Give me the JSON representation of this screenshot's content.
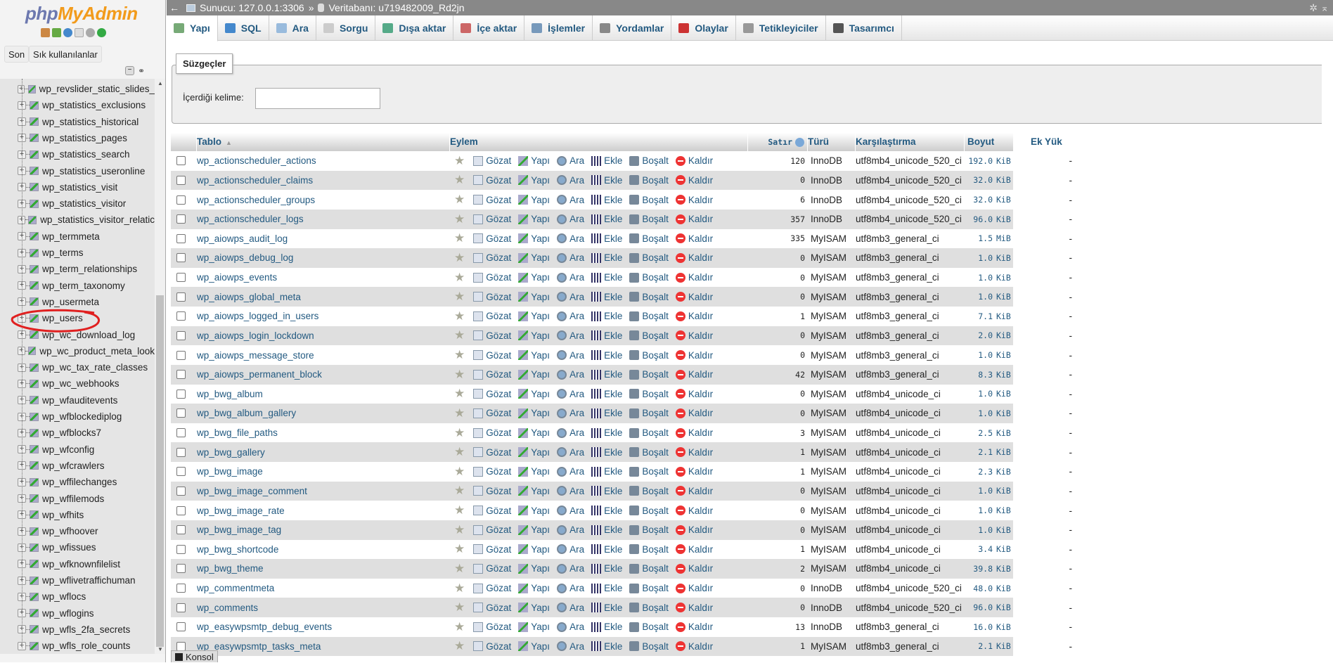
{
  "sidebar": {
    "logo": {
      "php": "php",
      "myadmin": "MyAdmin"
    },
    "quick_icons": [
      "home-icon",
      "exit-icon",
      "help-icon",
      "docs-icon",
      "settings-icon",
      "reload-icon"
    ],
    "buttons": {
      "recent": "Son",
      "favorites": "Sık kullanılanlar"
    },
    "tables": [
      "wp_revslider_static_slides_",
      "wp_statistics_exclusions",
      "wp_statistics_historical",
      "wp_statistics_pages",
      "wp_statistics_search",
      "wp_statistics_useronline",
      "wp_statistics_visit",
      "wp_statistics_visitor",
      "wp_statistics_visitor_relatic",
      "wp_termmeta",
      "wp_terms",
      "wp_term_relationships",
      "wp_term_taxonomy",
      "wp_usermeta",
      "wp_users",
      "wp_wc_download_log",
      "wp_wc_product_meta_look",
      "wp_wc_tax_rate_classes",
      "wp_wc_webhooks",
      "wp_wfauditevents",
      "wp_wfblockediplog",
      "wp_wfblocks7",
      "wp_wfconfig",
      "wp_wfcrawlers",
      "wp_wffilechanges",
      "wp_wffilemods",
      "wp_wfhits",
      "wp_wfhoover",
      "wp_wfissues",
      "wp_wfknownfilelist",
      "wp_wflivetraffichuman",
      "wp_wflocs",
      "wp_wflogins",
      "wp_wfls_2fa_secrets",
      "wp_wfls_role_counts"
    ],
    "highlighted": "wp_users",
    "annotation_color": "#e02020"
  },
  "breadcrumb": {
    "server": "Sunucu: 127.0.0.1:3306",
    "sep": "»",
    "database": "Veritabanı: u719482009_Rd2jn"
  },
  "tabs": [
    {
      "label": "Yapı",
      "icon": "structure-icon",
      "active": true
    },
    {
      "label": "SQL",
      "icon": "sql-icon"
    },
    {
      "label": "Ara",
      "icon": "search-icon"
    },
    {
      "label": "Sorgu",
      "icon": "query-icon"
    },
    {
      "label": "Dışa aktar",
      "icon": "export-icon"
    },
    {
      "label": "İçe aktar",
      "icon": "import-icon"
    },
    {
      "label": "İşlemler",
      "icon": "wrench-icon"
    },
    {
      "label": "Yordamlar",
      "icon": "routines-icon"
    },
    {
      "label": "Olaylar",
      "icon": "clock-icon"
    },
    {
      "label": "Tetikleyiciler",
      "icon": "triggers-icon"
    },
    {
      "label": "Tasarımcı",
      "icon": "designer-icon"
    }
  ],
  "filters": {
    "legend": "Süzgeçler",
    "label": "İçerdiği kelime:",
    "value": ""
  },
  "table": {
    "headers": {
      "name": "Tablo",
      "action": "Eylem",
      "rows": "Satır",
      "engine": "Türü",
      "collation": "Karşılaştırma",
      "size": "Boyut",
      "overhead": "Ek Yük"
    },
    "actions": [
      "Gözat",
      "Yapı",
      "Ara",
      "Ekle",
      "Boşalt",
      "Kaldır"
    ],
    "rows": [
      {
        "name": "wp_actionscheduler_actions",
        "rows": "120",
        "engine": "InnoDB",
        "collation": "utf8mb4_unicode_520_ci",
        "size": "192.0",
        "unit": "KiB",
        "overhead": "-"
      },
      {
        "name": "wp_actionscheduler_claims",
        "rows": "0",
        "engine": "InnoDB",
        "collation": "utf8mb4_unicode_520_ci",
        "size": "32.0",
        "unit": "KiB",
        "overhead": "-"
      },
      {
        "name": "wp_actionscheduler_groups",
        "rows": "6",
        "engine": "InnoDB",
        "collation": "utf8mb4_unicode_520_ci",
        "size": "32.0",
        "unit": "KiB",
        "overhead": "-"
      },
      {
        "name": "wp_actionscheduler_logs",
        "rows": "357",
        "engine": "InnoDB",
        "collation": "utf8mb4_unicode_520_ci",
        "size": "96.0",
        "unit": "KiB",
        "overhead": "-"
      },
      {
        "name": "wp_aiowps_audit_log",
        "rows": "335",
        "engine": "MyISAM",
        "collation": "utf8mb3_general_ci",
        "size": "1.5",
        "unit": "MiB",
        "overhead": "-"
      },
      {
        "name": "wp_aiowps_debug_log",
        "rows": "0",
        "engine": "MyISAM",
        "collation": "utf8mb3_general_ci",
        "size": "1.0",
        "unit": "KiB",
        "overhead": "-"
      },
      {
        "name": "wp_aiowps_events",
        "rows": "0",
        "engine": "MyISAM",
        "collation": "utf8mb3_general_ci",
        "size": "1.0",
        "unit": "KiB",
        "overhead": "-"
      },
      {
        "name": "wp_aiowps_global_meta",
        "rows": "0",
        "engine": "MyISAM",
        "collation": "utf8mb3_general_ci",
        "size": "1.0",
        "unit": "KiB",
        "overhead": "-"
      },
      {
        "name": "wp_aiowps_logged_in_users",
        "rows": "1",
        "engine": "MyISAM",
        "collation": "utf8mb3_general_ci",
        "size": "7.1",
        "unit": "KiB",
        "overhead": "-"
      },
      {
        "name": "wp_aiowps_login_lockdown",
        "rows": "0",
        "engine": "MyISAM",
        "collation": "utf8mb3_general_ci",
        "size": "2.0",
        "unit": "KiB",
        "overhead": "-"
      },
      {
        "name": "wp_aiowps_message_store",
        "rows": "0",
        "engine": "MyISAM",
        "collation": "utf8mb3_general_ci",
        "size": "1.0",
        "unit": "KiB",
        "overhead": "-"
      },
      {
        "name": "wp_aiowps_permanent_block",
        "rows": "42",
        "engine": "MyISAM",
        "collation": "utf8mb3_general_ci",
        "size": "8.3",
        "unit": "KiB",
        "overhead": "-"
      },
      {
        "name": "wp_bwg_album",
        "rows": "0",
        "engine": "MyISAM",
        "collation": "utf8mb4_unicode_ci",
        "size": "1.0",
        "unit": "KiB",
        "overhead": "-"
      },
      {
        "name": "wp_bwg_album_gallery",
        "rows": "0",
        "engine": "MyISAM",
        "collation": "utf8mb4_unicode_ci",
        "size": "1.0",
        "unit": "KiB",
        "overhead": "-"
      },
      {
        "name": "wp_bwg_file_paths",
        "rows": "3",
        "engine": "MyISAM",
        "collation": "utf8mb4_unicode_ci",
        "size": "2.5",
        "unit": "KiB",
        "overhead": "-"
      },
      {
        "name": "wp_bwg_gallery",
        "rows": "1",
        "engine": "MyISAM",
        "collation": "utf8mb4_unicode_ci",
        "size": "2.1",
        "unit": "KiB",
        "overhead": "-"
      },
      {
        "name": "wp_bwg_image",
        "rows": "1",
        "engine": "MyISAM",
        "collation": "utf8mb4_unicode_ci",
        "size": "2.3",
        "unit": "KiB",
        "overhead": "-"
      },
      {
        "name": "wp_bwg_image_comment",
        "rows": "0",
        "engine": "MyISAM",
        "collation": "utf8mb4_unicode_ci",
        "size": "1.0",
        "unit": "KiB",
        "overhead": "-"
      },
      {
        "name": "wp_bwg_image_rate",
        "rows": "0",
        "engine": "MyISAM",
        "collation": "utf8mb4_unicode_ci",
        "size": "1.0",
        "unit": "KiB",
        "overhead": "-"
      },
      {
        "name": "wp_bwg_image_tag",
        "rows": "0",
        "engine": "MyISAM",
        "collation": "utf8mb4_unicode_ci",
        "size": "1.0",
        "unit": "KiB",
        "overhead": "-"
      },
      {
        "name": "wp_bwg_shortcode",
        "rows": "1",
        "engine": "MyISAM",
        "collation": "utf8mb4_unicode_ci",
        "size": "3.4",
        "unit": "KiB",
        "overhead": "-"
      },
      {
        "name": "wp_bwg_theme",
        "rows": "2",
        "engine": "MyISAM",
        "collation": "utf8mb4_unicode_ci",
        "size": "39.8",
        "unit": "KiB",
        "overhead": "-"
      },
      {
        "name": "wp_commentmeta",
        "rows": "0",
        "engine": "InnoDB",
        "collation": "utf8mb4_unicode_520_ci",
        "size": "48.0",
        "unit": "KiB",
        "overhead": "-"
      },
      {
        "name": "wp_comments",
        "rows": "0",
        "engine": "InnoDB",
        "collation": "utf8mb4_unicode_520_ci",
        "size": "96.0",
        "unit": "KiB",
        "overhead": "-"
      },
      {
        "name": "wp_easywpsmtp_debug_events",
        "rows": "13",
        "engine": "InnoDB",
        "collation": "utf8mb3_general_ci",
        "size": "16.0",
        "unit": "KiB",
        "overhead": "-"
      },
      {
        "name": "wp_easywpsmtp_tasks_meta",
        "rows": "1",
        "engine": "MyISAM",
        "collation": "utf8mb3_general_ci",
        "size": "2.1",
        "unit": "KiB",
        "overhead": "-"
      }
    ]
  },
  "console": {
    "label": "Konsol"
  }
}
